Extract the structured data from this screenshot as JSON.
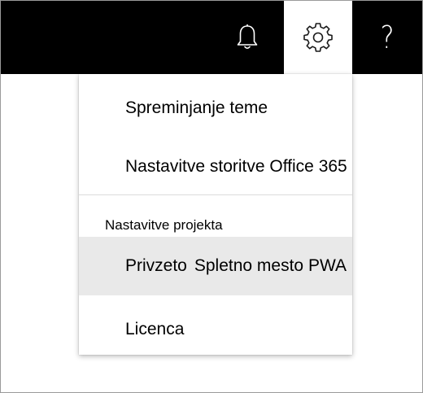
{
  "header": {
    "icons": {
      "notifications": "bell-icon",
      "settings": "gear-icon",
      "help": "question-icon"
    },
    "help_glyph": "?"
  },
  "settings_menu": {
    "items": [
      {
        "label": "Spreminjanje teme"
      },
      {
        "label": "Nastavitve storitve Office 365"
      }
    ],
    "section_title": "Nastavitve projekta",
    "project_items": [
      {
        "label_prefix": "Privzeto",
        "label_suffix": "Spletno mesto PWA",
        "highlighted": true
      },
      {
        "label": "Licenca"
      }
    ]
  },
  "colors": {
    "topbar": "#000000",
    "active_tab": "#ffffff",
    "highlight_row": "#e9e9e9",
    "divider": "#dcdcdc",
    "text": "#000000"
  }
}
